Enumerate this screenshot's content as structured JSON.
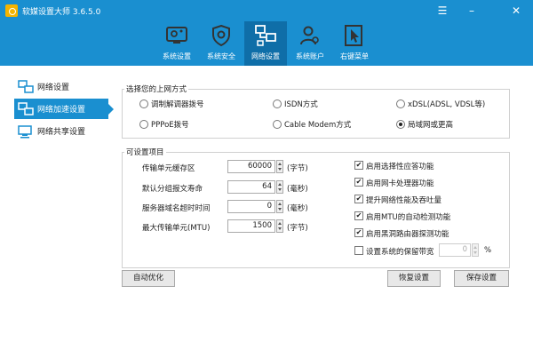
{
  "window": {
    "title": "软媒设置大师 3.6.5.0",
    "menu_glyph": "☰",
    "min_glyph": "–",
    "close_glyph": "✕"
  },
  "toolbar": {
    "items": [
      {
        "label": "系统设置",
        "icon": "system-settings-icon"
      },
      {
        "label": "系统安全",
        "icon": "shield-gear-icon"
      },
      {
        "label": "网络设置",
        "icon": "network-icon",
        "active": true
      },
      {
        "label": "系统账户",
        "icon": "users-icon"
      },
      {
        "label": "右键菜单",
        "icon": "cursor-menu-icon"
      }
    ]
  },
  "sidebar": {
    "items": [
      {
        "label": "网络设置",
        "icon": "network-settings-icon"
      },
      {
        "label": "网络加速设置",
        "icon": "network-speed-icon",
        "active": true
      },
      {
        "label": "网络共享设置",
        "icon": "network-share-icon"
      }
    ]
  },
  "connection": {
    "title": "选择您的上网方式",
    "options": [
      {
        "label": "调制解调器拨号",
        "selected": false
      },
      {
        "label": "ISDN方式",
        "selected": false
      },
      {
        "label": "xDSL(ADSL, VDSL等)",
        "selected": false
      },
      {
        "label": "PPPoE拨号",
        "selected": false
      },
      {
        "label": "Cable Modem方式",
        "selected": false
      },
      {
        "label": "局域网或更高",
        "selected": true
      }
    ]
  },
  "options": {
    "title": "可设置项目",
    "fields": [
      {
        "label": "传输单元缓存区",
        "value": "60000",
        "unit": "(字节)"
      },
      {
        "label": "默认分组报文寿命",
        "value": "64",
        "unit": "(毫秒)"
      },
      {
        "label": "服务器域名超时时间",
        "value": "0",
        "unit": "(毫秒)"
      },
      {
        "label": "最大传输单元(MTU)",
        "value": "1500",
        "unit": "(字节)"
      }
    ],
    "checks": [
      {
        "label": "启用选择性应答功能",
        "checked": true
      },
      {
        "label": "启用网卡处理器功能",
        "checked": true
      },
      {
        "label": "提升网络性能及吞吐量",
        "checked": true
      },
      {
        "label": "启用MTU的自动检测功能",
        "checked": true
      },
      {
        "label": "启用黑洞路由器探测功能",
        "checked": true
      },
      {
        "label": "设置系统的保留带宽",
        "checked": false
      }
    ],
    "bandwidth": {
      "value": "0",
      "unit": "%"
    }
  },
  "buttons": {
    "auto_optimize": "自动优化",
    "restore": "恢复设置",
    "save": "保存设置"
  },
  "colors": {
    "accent": "#1a8fd0",
    "accent_dark": "#0f6ea8"
  }
}
